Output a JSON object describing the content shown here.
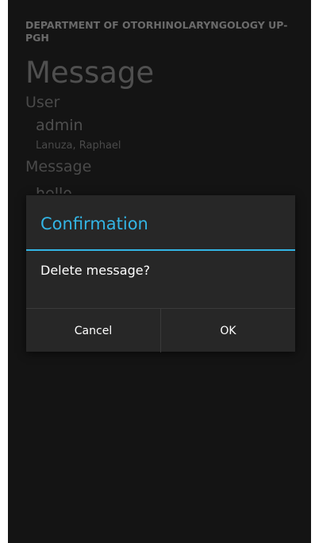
{
  "background": {
    "department": "DEPARTMENT OF OTORHINOLARYNGOLOGY UP-PGH",
    "page_title": "Message",
    "user_label": "User",
    "user_login": "admin",
    "user_fullname": "Lanuza, Raphael",
    "message_label": "Message",
    "message_preview": "hello"
  },
  "dialog": {
    "title": "Confirmation",
    "message": "Delete message?",
    "cancel_label": "Cancel",
    "ok_label": "OK"
  },
  "colors": {
    "accent": "#33b5e5",
    "screen_bg": "#141414",
    "dialog_bg": "#272727"
  }
}
